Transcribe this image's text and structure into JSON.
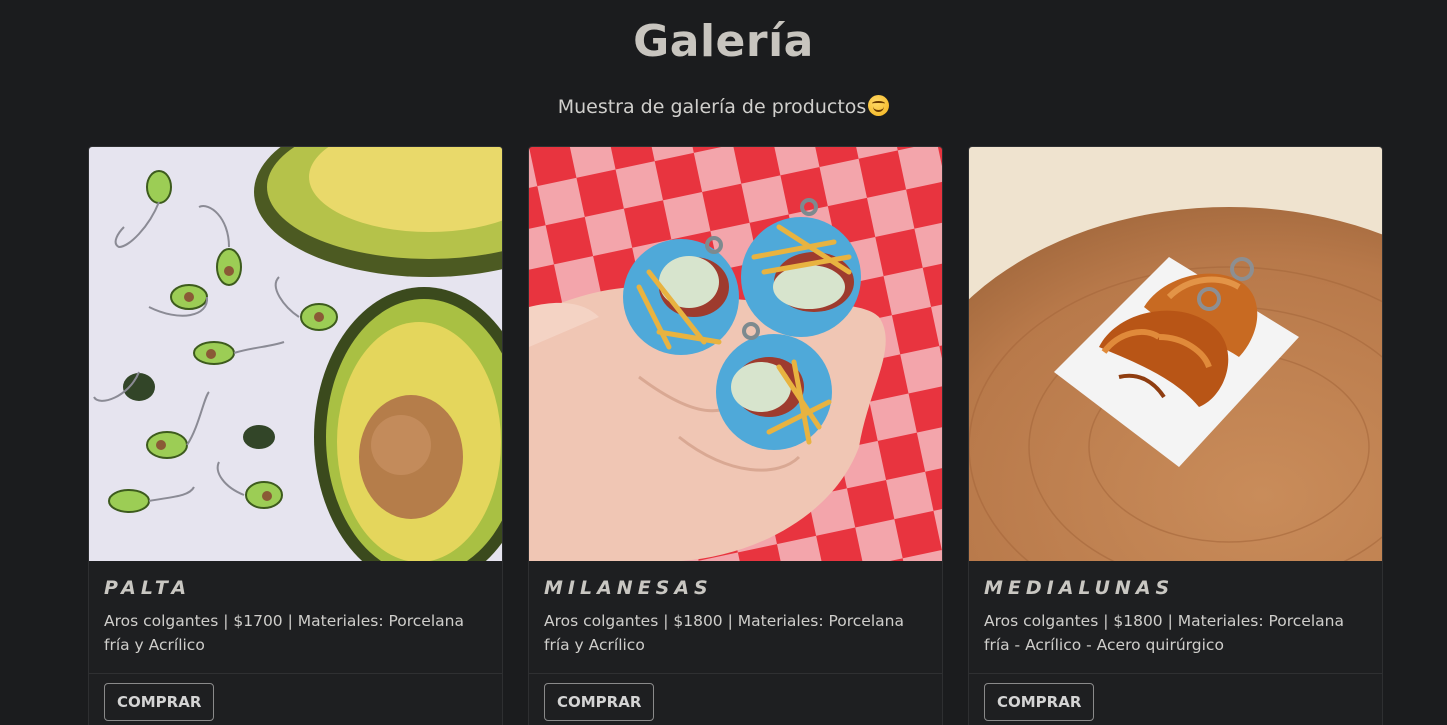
{
  "header": {
    "title": "Galería",
    "subtitle": "Muestra de galería de productos"
  },
  "products": [
    {
      "name": "PALTA",
      "description": "Aros colgantes | $1700 | Materiales: Porcelana fría y Acrílico",
      "button_label": "COMPRAR"
    },
    {
      "name": "MILANESAS",
      "description": "Aros colgantes | $1800 | Materiales: Porcelana fría y Acrílico",
      "button_label": "COMPRAR"
    },
    {
      "name": "MEDIALUNAS",
      "description": "Aros colgantes | $1800 | Materiales: Porcelana fría - Acrílico - Acero quirúrgico",
      "button_label": "COMPRAR"
    }
  ],
  "colors": {
    "background": "#1b1c1e",
    "card": "#1e1f21",
    "text": "#cfcecb"
  }
}
